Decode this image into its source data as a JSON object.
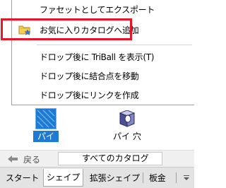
{
  "context_menu": {
    "items": [
      {
        "label": "ファセットとしてエクスポート"
      },
      {
        "label": "お気に入りカタログへ追加",
        "icon": "folder-star-icon",
        "highlighted": true
      },
      {
        "label": "ドロップ後に TriBall を表示(T)"
      },
      {
        "label": "ドロップ後に結合点を移動"
      },
      {
        "label": "ドロップ後にリンクを作成"
      }
    ],
    "highlight_color": "#e8142a"
  },
  "catalog": {
    "items": [
      {
        "label": "パイ",
        "selected": true
      },
      {
        "label": "パイ 穴",
        "selected": false
      }
    ],
    "selection_color": "#1e7ad4"
  },
  "navigation": {
    "back_label": "戻る",
    "catalog_select_value": "すべてのカタログ"
  },
  "tabs": [
    {
      "label": "スタート",
      "active": false
    },
    {
      "label": "シェイプ",
      "active": true
    },
    {
      "label": "拡張シェイプ",
      "active": false
    },
    {
      "label": "板金",
      "active": false
    }
  ]
}
